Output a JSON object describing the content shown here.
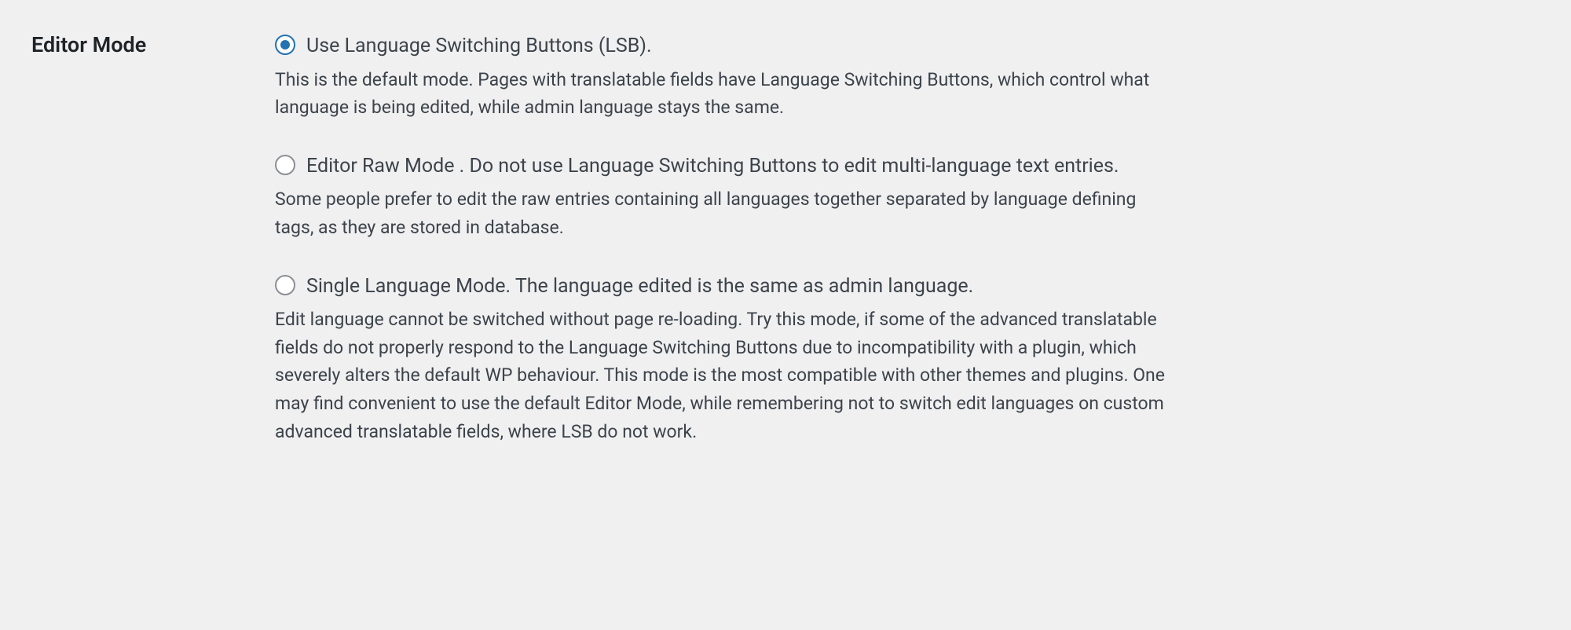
{
  "section_title": "Editor Mode",
  "options": [
    {
      "label": "Use Language Switching Buttons (LSB).",
      "description": "This is the default mode. Pages with translatable fields have Language Switching Buttons, which control what language is being edited, while admin language stays the same.",
      "checked": true
    },
    {
      "label": "Editor Raw Mode . Do not use Language Switching Buttons to edit multi-language text entries.",
      "description": "Some people prefer to edit the raw entries containing all languages together separated by language defining tags, as they are stored in database.",
      "checked": false
    },
    {
      "label": "Single Language Mode. The language edited is the same as admin language.",
      "description": "Edit language cannot be switched without page re-loading. Try this mode, if some of the advanced translatable fields do not properly respond to the Language Switching Buttons due to incompatibility with a plugin, which severely alters the default WP behaviour. This mode is the most compatible with other themes and plugins. One may find convenient to use the default Editor Mode, while remembering not to switch edit languages on custom advanced translatable fields, where LSB do not work.",
      "checked": false
    }
  ]
}
